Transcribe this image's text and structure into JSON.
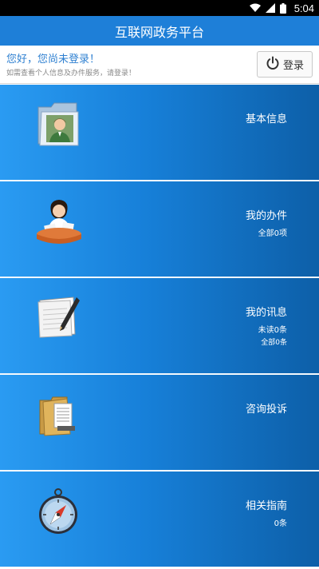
{
  "status_bar": {
    "time": "5:04",
    "icons": [
      "wifi-icon",
      "signal-icon",
      "battery-icon"
    ]
  },
  "app_bar": {
    "title": "互联网政务平台"
  },
  "login": {
    "greeting": "您好，您尚未登录！",
    "hint": "如需查看个人信息及办件服务，请登录！",
    "button_label": "登录",
    "button_icon": "power-icon"
  },
  "menu": {
    "items": [
      {
        "title": "基本信息",
        "icon": "user-folder-icon"
      },
      {
        "title": "我的办件",
        "sub1": "全部0项",
        "icon": "office-worker-icon"
      },
      {
        "title": "我的讯息",
        "sub1": "未读0条",
        "sub2": "全部0条",
        "icon": "notepad-pen-icon"
      },
      {
        "title": "咨询投诉",
        "icon": "document-folder-icon"
      },
      {
        "title": "相关指南",
        "sub1": "0条",
        "icon": "compass-icon"
      }
    ]
  },
  "colors": {
    "status_bar": "#000000",
    "app_bar": "#1e7fd8",
    "greeting": "#2f80d1",
    "menu_gradient_start": "#2a9bf2",
    "menu_gradient_end": "#0d5fa8"
  }
}
